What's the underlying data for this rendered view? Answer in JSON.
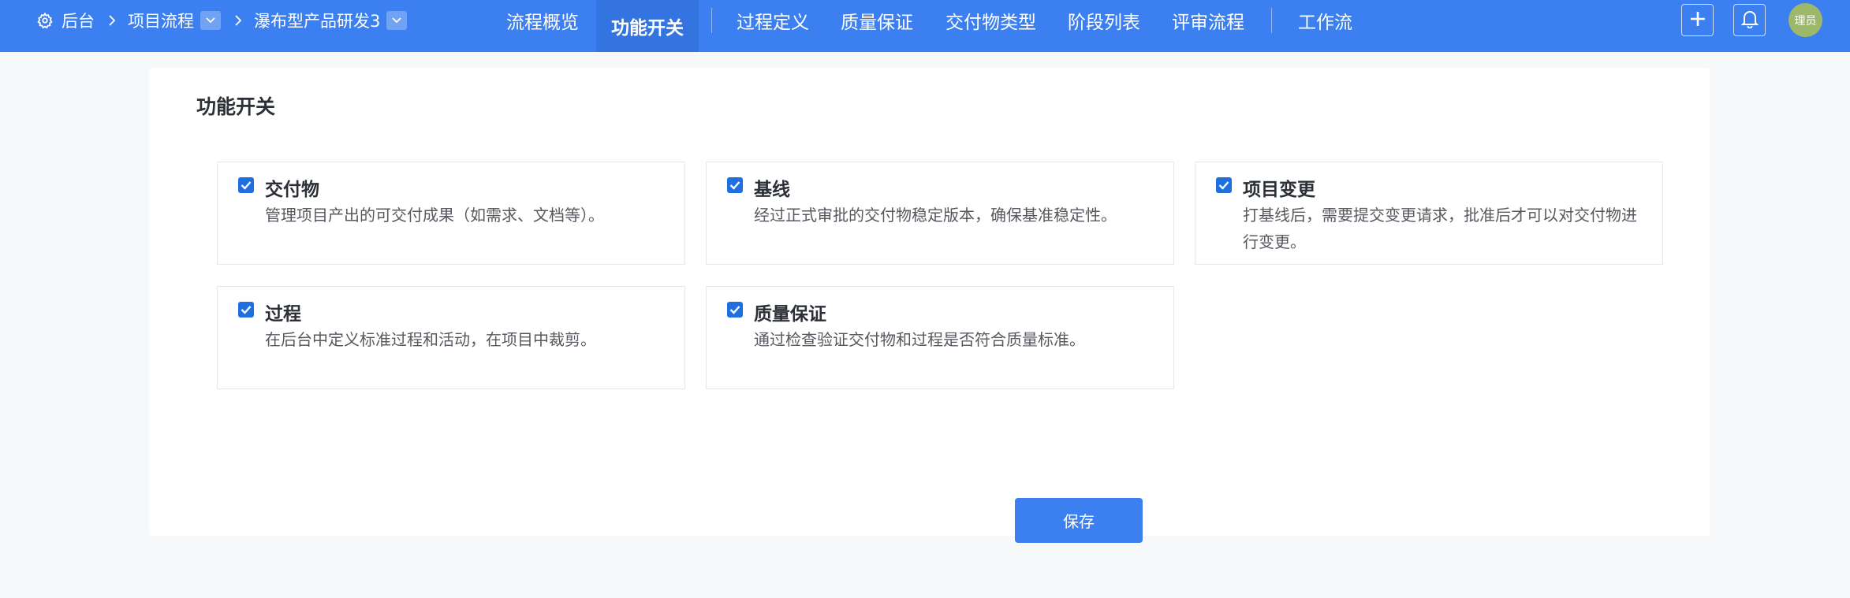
{
  "breadcrumb": {
    "items": [
      "后台",
      "项目流程",
      "瀑布型产品研发3"
    ]
  },
  "nav": {
    "tabs": [
      {
        "label": "流程概览",
        "active": false
      },
      {
        "label": "功能开关",
        "active": true
      },
      {
        "label": "过程定义",
        "active": false
      },
      {
        "label": "质量保证",
        "active": false
      },
      {
        "label": "交付物类型",
        "active": false
      },
      {
        "label": "阶段列表",
        "active": false
      },
      {
        "label": "评审流程",
        "active": false
      },
      {
        "label": "工作流",
        "active": false
      }
    ]
  },
  "header": {
    "add_icon": "plus-icon",
    "bell_icon": "bell-icon",
    "avatar_text": "理员"
  },
  "main": {
    "title": "功能开关",
    "options": [
      {
        "name": "交付物",
        "desc": "管理项目产出的可交付成果（如需求、文档等）。",
        "checked": true
      },
      {
        "name": "基线",
        "desc": "经过正式审批的交付物稳定版本，确保基准稳定性。",
        "checked": true
      },
      {
        "name": "项目变更",
        "desc": "打基线后，需要提交变更请求，批准后才可以对交付物进行变更。",
        "checked": true
      },
      {
        "name": "过程",
        "desc": "在后台中定义标准过程和活动，在项目中裁剪。",
        "checked": true
      },
      {
        "name": "质量保证",
        "desc": "通过检查验证交付物和过程是否符合质量标准。",
        "checked": true
      }
    ],
    "save_label": "保存"
  },
  "colors": {
    "topbar": "#3b7ff0",
    "active_tab": "#3474e0",
    "checkbox": "#1f6fe0",
    "avatar": "#9cb86a",
    "background": "#f7f8fa"
  }
}
